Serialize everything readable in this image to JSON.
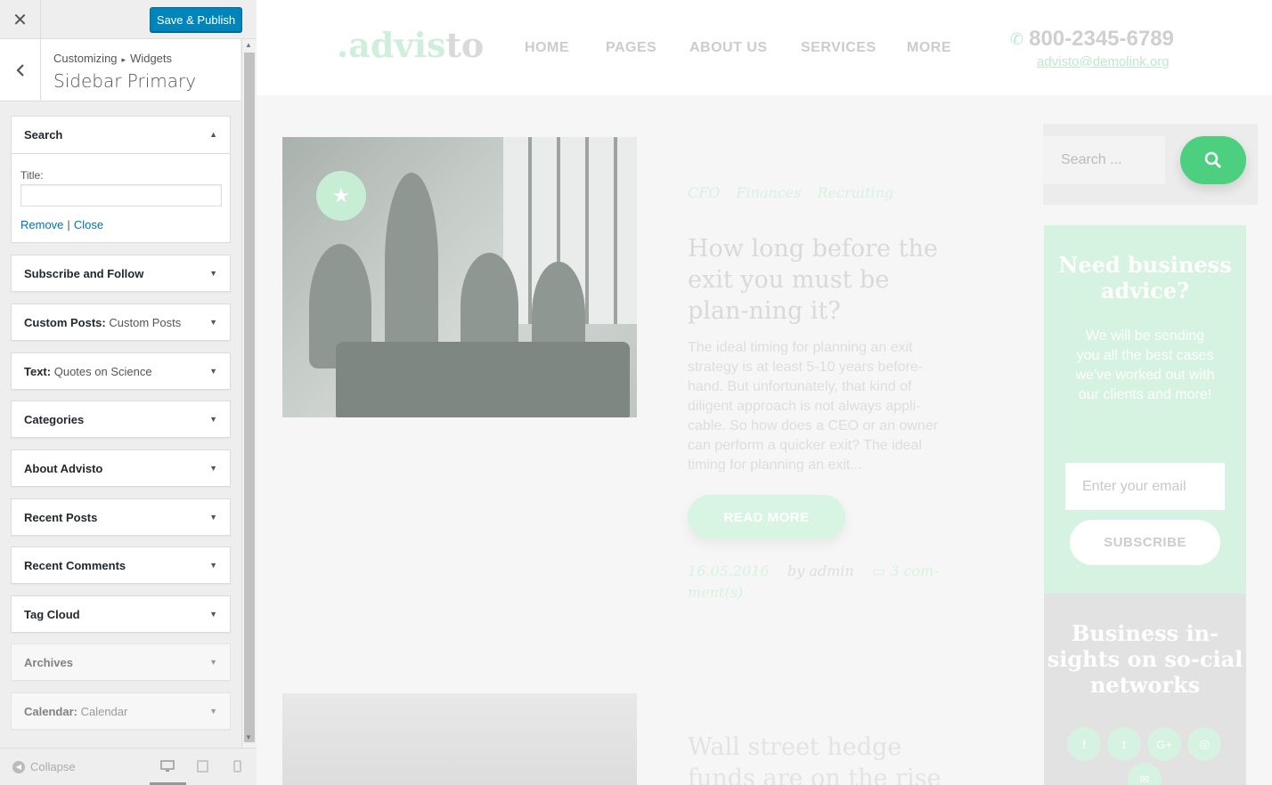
{
  "customizer": {
    "close_icon": "close-icon",
    "publish_label": "Save & Publish",
    "breadcrumb": [
      "Customizing",
      "Widgets"
    ],
    "panel_title": "Sidebar Primary",
    "search_widget": {
      "label": "Search",
      "title_label": "Title:",
      "title_value": "",
      "remove_label": "Remove",
      "close_label": "Close"
    },
    "widgets": [
      {
        "label": "Subscribe and Follow",
        "sub": ""
      },
      {
        "label": "Custom Posts:",
        "sub": "Custom Posts"
      },
      {
        "label": "Text:",
        "sub": "Quotes on Science"
      },
      {
        "label": "Categories",
        "sub": ""
      },
      {
        "label": "About Advisto",
        "sub": ""
      },
      {
        "label": "Recent Posts",
        "sub": ""
      },
      {
        "label": "Recent Comments",
        "sub": ""
      },
      {
        "label": "Tag Cloud",
        "sub": ""
      },
      {
        "label": "Archives",
        "sub": ""
      },
      {
        "label": "Calendar:",
        "sub": "Calendar"
      }
    ],
    "collapse_label": "Collapse"
  },
  "site": {
    "logo_a": ".advis",
    "logo_b": "to",
    "nav": [
      "HOME",
      "PAGES",
      "ABOUT US",
      "SERVICES",
      "MORE"
    ],
    "phone": "800-2345-6789",
    "email": "advisto@demolink.org",
    "post": {
      "tags": [
        "CFO",
        "Finances",
        "Recruiting"
      ],
      "title": "How long before the exit you must be plan-ning it?",
      "excerpt": "The ideal timing for planning an exit strategy is at least 5-10 years before-hand. But unfortunately, that kind of diligent approach is not always appli-cable. So how does a CEO or an owner can perform a quicker exit? The ideal timing for planning an exit...",
      "read_more": "READ MORE",
      "date": "16.05.2016",
      "author": "by admin",
      "comments": "3 com-ment(s)"
    },
    "post2_title": "Wall street hedge funds are on the rise",
    "search_placeholder": "Search ...",
    "advice": {
      "title": "Need business advice?",
      "text": "We will be sending you all the best cases we've worked out with our clients and more!",
      "email_placeholder": "Enter your email",
      "subscribe": "SUBSCRIBE"
    },
    "social_title": "Business in-sights on so-cial networks",
    "social_icons": [
      "f",
      "t",
      "G+",
      "◎",
      "✉"
    ]
  },
  "colors": {
    "publish_blue": "#0085ba",
    "link_blue": "#0073aa",
    "green": "#4ccf7f",
    "green_faded": "#d5f3e0"
  }
}
